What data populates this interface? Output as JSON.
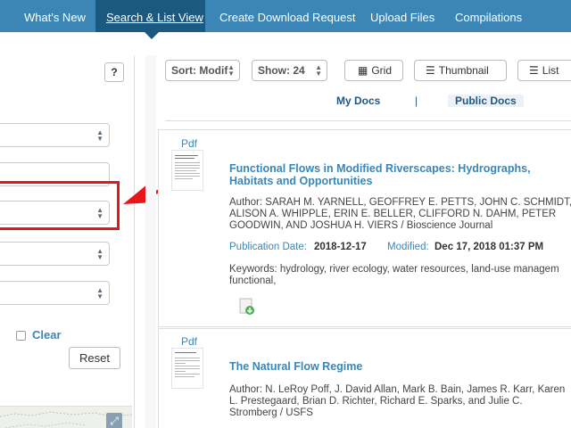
{
  "nav": {
    "items": [
      {
        "label": "What's New"
      },
      {
        "label": "Search & List View",
        "active": true
      },
      {
        "label": "Create Download Request"
      },
      {
        "label": "Upload Files"
      },
      {
        "label": "Compilations"
      }
    ]
  },
  "filters": {
    "help_label": "?",
    "clear_label": "Clear",
    "reset_label": "Reset"
  },
  "toolbar": {
    "sort_label": "Sort: Modif",
    "show_label": "Show: 24",
    "grid_label": "Grid",
    "thumbnail_label": "Thumbnail",
    "list_label": "List"
  },
  "tabs": {
    "my_docs": "My Docs",
    "separator": "|",
    "public_docs": "Public Docs"
  },
  "results": [
    {
      "format": "Pdf",
      "title": "Functional Flows in Modified Riverscapes: Hydrographs, Habitats and Opportunities",
      "author": "Author: SARAH M. YARNELL, GEOFFREY E. PETTS, JOHN C. SCHMIDT,\nALISON A. WHIPPLE, ERIN E. BELLER, CLIFFORD N. DAHM, PETER\nGOODWIN, AND JOSHUA H. VIERS / Bioscience Journal",
      "pub_label": "Publication Date:",
      "pub_date": "2018-12-17",
      "mod_label": "Modified:",
      "mod_date": "Dec 17, 2018 01:37 PM",
      "keywords": "Keywords: hydrology, river ecology, water resources, land-use managem\nfunctional,"
    },
    {
      "format": "Pdf",
      "title": "The Natural Flow Regime",
      "author": "Author: N. LeRoy Poff, J. David Allan, Mark B. Bain, James R. Karr, Karen\nL. Prestegaard, Brian D. Richter, Richard E. Sparks, and Julie C.\nStromberg / USFS"
    }
  ],
  "colors": {
    "nav_bg": "#3b86b5",
    "nav_active": "#1c5980",
    "link": "#3b86b5",
    "highlight": "#e8151b"
  }
}
